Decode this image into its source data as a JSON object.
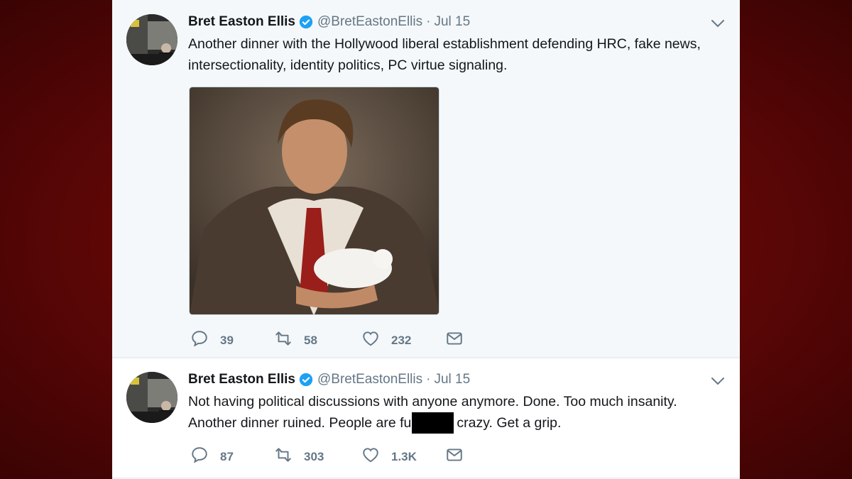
{
  "tweets": [
    {
      "author": "Bret Easton Ellis",
      "handle": "@BretEastonEllis",
      "separator": "·",
      "date": "Jul 15",
      "text": "Another dinner with the Hollywood liberal establishment defending HRC, fake news, intersectionality, identity politics, PC virtue signaling.",
      "replies": "39",
      "retweets": "58",
      "likes": "232"
    },
    {
      "author": "Bret Easton Ellis",
      "handle": "@BretEastonEllis",
      "separator": "·",
      "date": "Jul 15",
      "text_before_redaction": "Not having political discussions with anyone anymore. Done. Too much insanity. Another dinner ruined. People are fu",
      "text_after_redaction": "crazy. Get a grip.",
      "replies": "87",
      "retweets": "303",
      "likes": "1.3K"
    }
  ],
  "colors": {
    "background": "#6b0808",
    "verified": "#1da1f2",
    "muted": "#657786",
    "text": "#14171a"
  },
  "icons": [
    "verified-badge-icon",
    "chevron-down-icon",
    "reply-icon",
    "retweet-icon",
    "like-icon",
    "direct-message-icon"
  ]
}
